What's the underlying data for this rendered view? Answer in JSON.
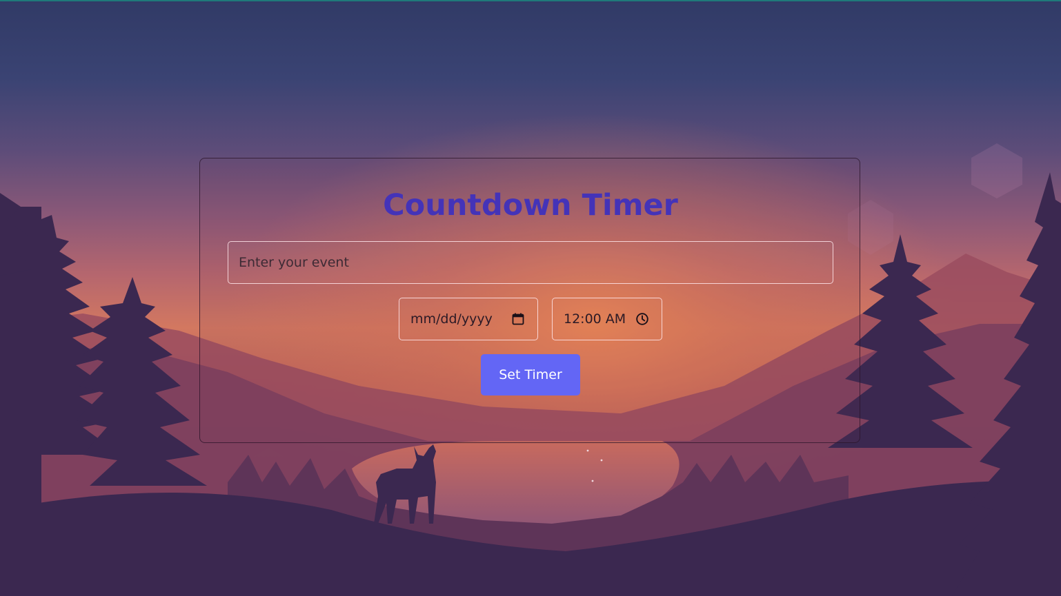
{
  "page": {
    "title": "Countdown Timer"
  },
  "form": {
    "event_placeholder": "Enter your event",
    "date_placeholder": "mm/dd/yyyy",
    "time_value": "12:00 AM",
    "submit_label": "Set Timer"
  },
  "icons": {
    "date": "calendar-icon",
    "time": "clock-icon"
  },
  "colors": {
    "title": "#4433b8",
    "button": "#6366f5",
    "button_text": "#ffffff"
  }
}
